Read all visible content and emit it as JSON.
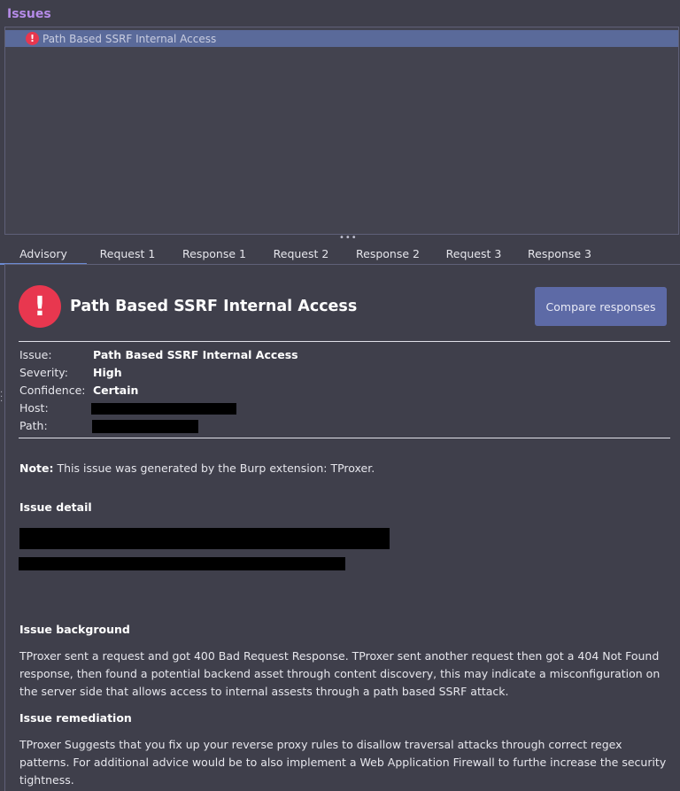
{
  "issues_panel": {
    "title": "Issues",
    "items": [
      {
        "label": "Path Based SSRF Internal Access",
        "icon": "alert-icon"
      }
    ]
  },
  "tabs": [
    {
      "label": "Advisory",
      "active": true
    },
    {
      "label": "Request 1"
    },
    {
      "label": "Response 1"
    },
    {
      "label": "Request 2"
    },
    {
      "label": "Response 2"
    },
    {
      "label": "Request 3"
    },
    {
      "label": "Response 3"
    }
  ],
  "advisory": {
    "title": "Path Based SSRF Internal Access",
    "compare_button": "Compare responses",
    "fields": {
      "issue_label": "Issue:",
      "issue_value": "Path Based SSRF Internal Access",
      "severity_label": "Severity:",
      "severity_value": "High",
      "confidence_label": "Confidence:",
      "confidence_value": "Certain",
      "host_label": "Host:",
      "path_label": "Path:"
    },
    "note_label": "Note:",
    "note_text": " This issue was generated by the Burp extension: TProxer.",
    "issue_detail_heading": "Issue detail",
    "issue_background_heading": "Issue background",
    "issue_background_text": "TProxer sent a request and got 400 Bad Request Response. TProxer sent another request then got a 404 Not Found response, then found a potential backend asset through content discovery, this may indicate a misconfiguration on the server side that allows access to internal assests through a path based SSRF attack.",
    "issue_remediation_heading": "Issue remediation",
    "issue_remediation_text": "TProxer Suggests that you fix up your reverse proxy rules to disallow traversal attacks through correct regex patterns. For additional advice would be to also implement a Web Application Firewall to furthe increase the security tightness."
  },
  "colors": {
    "background": "#3f3f4b",
    "accent_purple": "#b58be8",
    "selection": "#5a6a9a",
    "severity_red": "#e8374f",
    "button": "#5d6aa6"
  }
}
